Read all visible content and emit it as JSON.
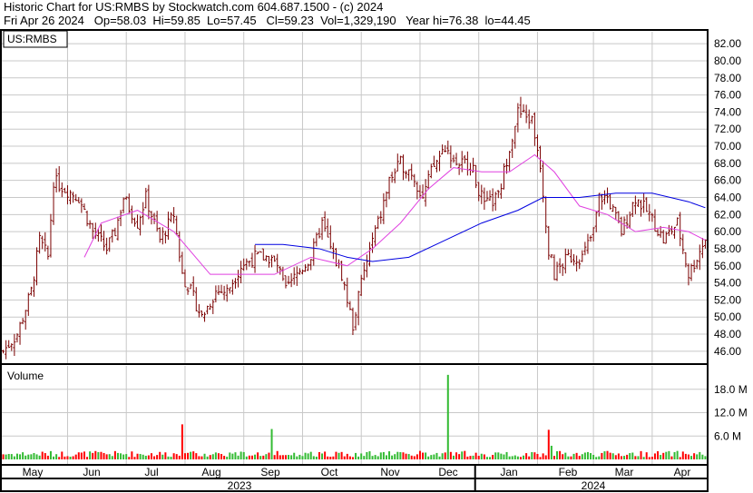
{
  "header": {
    "title": "Historic Chart for US:RMBS by Stockwatch.com 604.687.1500 - (c) 2024",
    "stats": "Fri Apr 26 2024   Op=58.03  Hi=59.85  Lo=57.45   Cl=59.23  Vol=1,329,190   Year hi=76.38  lo=44.45"
  },
  "chart_data": {
    "type": "candlestick",
    "symbol": "US:RMBS",
    "price_axis": {
      "ticks": [
        46,
        48,
        50,
        52,
        54,
        56,
        58,
        60,
        62,
        64,
        66,
        68,
        70,
        72,
        74,
        76,
        78,
        80,
        82
      ],
      "labels": [
        "46.00",
        "48.00",
        "50.00",
        "52.00",
        "54.00",
        "56.00",
        "58.00",
        "60.00",
        "62.00",
        "64.00",
        "66.00",
        "68.00",
        "70.00",
        "72.00",
        "74.00",
        "76.00",
        "78.00",
        "80.00",
        "82.00"
      ],
      "range": [
        44.6,
        83.4
      ]
    },
    "volume_axis": {
      "title": "Volume",
      "ticks": [
        6,
        12,
        18
      ],
      "labels": [
        "6.0 M",
        "12.0 M",
        "18.0 M"
      ],
      "range": [
        0,
        24
      ]
    },
    "months": [
      "May",
      "Jun",
      "Jul",
      "Aug",
      "Sep",
      "Oct",
      "Nov",
      "Dec",
      "Jan",
      "Feb",
      "Mar",
      "Apr"
    ],
    "years": [
      "2023",
      "2024"
    ],
    "trading_days": 252,
    "close_keyframes": [
      [
        0,
        46
      ],
      [
        5,
        48
      ],
      [
        10,
        53
      ],
      [
        13,
        59
      ],
      [
        16,
        57
      ],
      [
        18,
        66
      ],
      [
        22,
        65
      ],
      [
        27,
        64
      ],
      [
        32,
        60
      ],
      [
        37,
        58
      ],
      [
        40,
        60
      ],
      [
        43,
        64
      ],
      [
        48,
        61
      ],
      [
        51,
        64
      ],
      [
        56,
        59
      ],
      [
        61,
        62
      ],
      [
        64,
        55
      ],
      [
        67,
        53
      ],
      [
        71,
        50
      ],
      [
        76,
        53
      ],
      [
        80,
        53
      ],
      [
        85,
        56
      ],
      [
        90,
        57
      ],
      [
        95,
        57
      ],
      [
        98,
        56
      ],
      [
        101,
        53
      ],
      [
        105,
        55
      ],
      [
        110,
        57
      ],
      [
        114,
        61
      ],
      [
        117,
        58
      ],
      [
        121,
        55
      ],
      [
        125,
        49
      ],
      [
        128,
        54
      ],
      [
        132,
        59
      ],
      [
        135,
        62
      ],
      [
        138,
        66
      ],
      [
        142,
        68
      ],
      [
        146,
        67
      ],
      [
        150,
        64
      ],
      [
        153,
        67
      ],
      [
        158,
        70
      ],
      [
        162,
        68
      ],
      [
        167,
        68
      ],
      [
        172,
        63
      ],
      [
        177,
        64
      ],
      [
        181,
        70
      ],
      [
        184,
        74
      ],
      [
        189,
        73
      ],
      [
        192,
        68
      ],
      [
        195,
        58
      ],
      [
        197,
        55
      ],
      [
        202,
        57
      ],
      [
        207,
        57
      ],
      [
        211,
        60
      ],
      [
        213,
        64
      ],
      [
        216,
        64
      ],
      [
        221,
        60
      ],
      [
        226,
        64
      ],
      [
        231,
        62
      ],
      [
        236,
        59
      ],
      [
        241,
        61
      ],
      [
        245,
        55
      ],
      [
        248,
        57
      ],
      [
        251,
        59.23
      ]
    ],
    "ma_short": [
      [
        29,
        57
      ],
      [
        35,
        61
      ],
      [
        48,
        62.5
      ],
      [
        61,
        60
      ],
      [
        74,
        55
      ],
      [
        84,
        55
      ],
      [
        97,
        55
      ],
      [
        110,
        57
      ],
      [
        123,
        56
      ],
      [
        132,
        58
      ],
      [
        142,
        61
      ],
      [
        152,
        65
      ],
      [
        161,
        67.5
      ],
      [
        171,
        67
      ],
      [
        181,
        67
      ],
      [
        190,
        69
      ],
      [
        197,
        67
      ],
      [
        206,
        63
      ],
      [
        216,
        62
      ],
      [
        226,
        60
      ],
      [
        236,
        60.5
      ],
      [
        245,
        60
      ],
      [
        251,
        59
      ]
    ],
    "ma_long": [
      [
        90,
        58.5
      ],
      [
        100,
        58.5
      ],
      [
        113,
        58
      ],
      [
        123,
        57
      ],
      [
        132,
        56.5
      ],
      [
        145,
        57
      ],
      [
        158,
        59
      ],
      [
        171,
        61
      ],
      [
        184,
        62.5
      ],
      [
        193,
        64
      ],
      [
        206,
        64
      ],
      [
        219,
        64.5
      ],
      [
        232,
        64.5
      ],
      [
        245,
        63.5
      ],
      [
        251,
        62.8
      ]
    ],
    "volume_spikes_M": [
      [
        64,
        9
      ],
      [
        96,
        7.8
      ],
      [
        159,
        21.7
      ],
      [
        195,
        7.6
      ],
      [
        196,
        3.5
      ]
    ],
    "colors": {
      "bar": "#7a0000",
      "ma_short": "#e040e0",
      "ma_long": "#0000e0",
      "vol_up": "#33bb33",
      "vol_down": "#ff0000",
      "grid": "#c8c8c8"
    }
  }
}
